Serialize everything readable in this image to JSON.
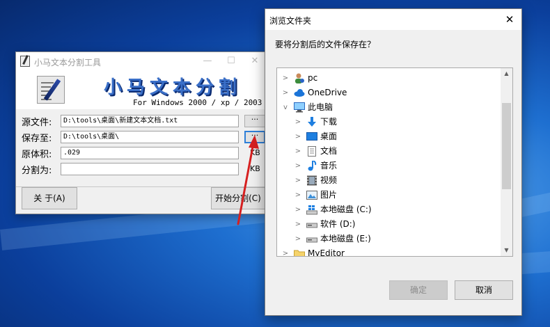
{
  "app": {
    "title": "小马文本分割工具",
    "min": "—",
    "max": "☐",
    "close": "✕",
    "banner_title": "小马文本分割",
    "banner_sub": "For Windows 2000 / xp / 2003",
    "labels": {
      "source": "源文件:",
      "save_to": "保存至:",
      "orig_size": "原体积:",
      "split_to": "分割为:"
    },
    "fields": {
      "source": "D:\\tools\\桌面\\新建文本文档.txt",
      "save_to": "D:\\tools\\桌面\\",
      "orig_size": ".029",
      "split_to": ""
    },
    "browse_label": "···",
    "unit": "KB",
    "about_button": "关 于(A)",
    "start_button": "开始分割(C)"
  },
  "dialog": {
    "title": "浏览文件夹",
    "close": "✕",
    "prompt": "要将分割后的文件保存在？",
    "tree": [
      {
        "label": "pc",
        "icon": "user-icon"
      },
      {
        "label": "OneDrive",
        "icon": "cloud-icon"
      },
      {
        "label": "此电脑",
        "icon": "computer-icon"
      },
      {
        "label": "下载",
        "icon": "download-icon"
      },
      {
        "label": "桌面",
        "icon": "desktop-icon"
      },
      {
        "label": "文档",
        "icon": "document-icon"
      },
      {
        "label": "音乐",
        "icon": "music-icon"
      },
      {
        "label": "视频",
        "icon": "video-icon"
      },
      {
        "label": "图片",
        "icon": "picture-icon"
      },
      {
        "label": "本地磁盘 (C:)",
        "icon": "windows-drive-icon"
      },
      {
        "label": "软件 (D:)",
        "icon": "drive-icon"
      },
      {
        "label": "本地磁盘 (E:)",
        "icon": "drive-icon"
      },
      {
        "label": "MyEditor",
        "icon": "folder-icon"
      }
    ],
    "ok_button": "确定",
    "cancel_button": "取消"
  },
  "colors": {
    "accent": "#2e7fd8",
    "arrow": "#d62020",
    "banner_text": "#3a6fc8"
  }
}
